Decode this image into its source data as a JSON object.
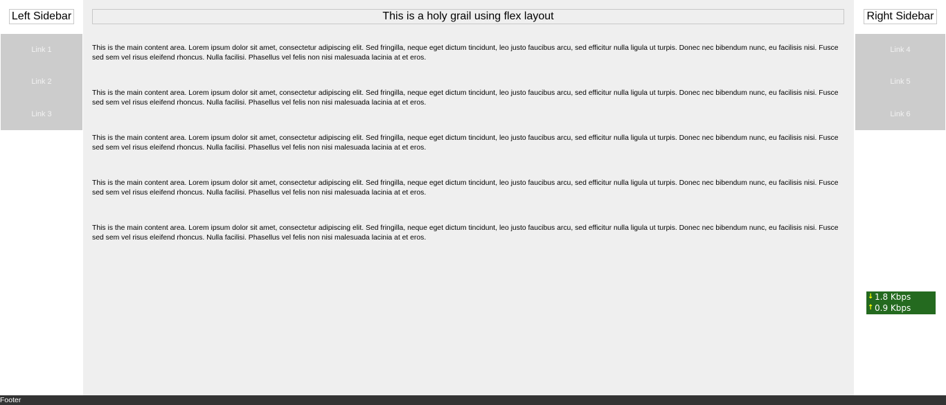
{
  "left_sidebar": {
    "title": "Left Sidebar",
    "links": [
      "Link 1",
      "Link 2",
      "Link 3"
    ]
  },
  "main": {
    "title": "This is a holy grail using flex layout",
    "paragraphs": [
      "This is the main content area. Lorem ipsum dolor sit amet, consectetur adipiscing elit. Sed fringilla, neque eget dictum tincidunt, leo justo faucibus arcu, sed efficitur nulla ligula ut turpis. Donec nec bibendum nunc, eu facilisis nisi. Fusce sed sem vel risus eleifend rhoncus. Nulla facilisi. Phasellus vel felis non nisi malesuada lacinia at et eros.",
      "This is the main content area. Lorem ipsum dolor sit amet, consectetur adipiscing elit. Sed fringilla, neque eget dictum tincidunt, leo justo faucibus arcu, sed efficitur nulla ligula ut turpis. Donec nec bibendum nunc, eu facilisis nisi. Fusce sed sem vel risus eleifend rhoncus. Nulla facilisi. Phasellus vel felis non nisi malesuada lacinia at et eros.",
      "This is the main content area. Lorem ipsum dolor sit amet, consectetur adipiscing elit. Sed fringilla, neque eget dictum tincidunt, leo justo faucibus arcu, sed efficitur nulla ligula ut turpis. Donec nec bibendum nunc, eu facilisis nisi. Fusce sed sem vel risus eleifend rhoncus. Nulla facilisi. Phasellus vel felis non nisi malesuada lacinia at et eros.",
      "This is the main content area. Lorem ipsum dolor sit amet, consectetur adipiscing elit. Sed fringilla, neque eget dictum tincidunt, leo justo faucibus arcu, sed efficitur nulla ligula ut turpis. Donec nec bibendum nunc, eu facilisis nisi. Fusce sed sem vel risus eleifend rhoncus. Nulla facilisi. Phasellus vel felis non nisi malesuada lacinia at et eros.",
      "This is the main content area. Lorem ipsum dolor sit amet, consectetur adipiscing elit. Sed fringilla, neque eget dictum tincidunt, leo justo faucibus arcu, sed efficitur nulla ligula ut turpis. Donec nec bibendum nunc, eu facilisis nisi. Fusce sed sem vel risus eleifend rhoncus. Nulla facilisi. Phasellus vel felis non nisi malesuada lacinia at et eros."
    ]
  },
  "right_sidebar": {
    "title": "Right Sidebar",
    "links": [
      "Link 4",
      "Link 5",
      "Link 6"
    ]
  },
  "network_widget": {
    "download": "1.8 Kbps",
    "upload": "0.9 Kbps",
    "download_icon": "down-arrow-icon",
    "upload_icon": "up-arrow-icon",
    "background_color": "#246a1f",
    "arrow_color": "#ffff00"
  },
  "footer": {
    "text": "Footer"
  },
  "colors": {
    "main_background": "#efefef",
    "nav_background": "#cccccc",
    "footer_background": "#333333"
  }
}
